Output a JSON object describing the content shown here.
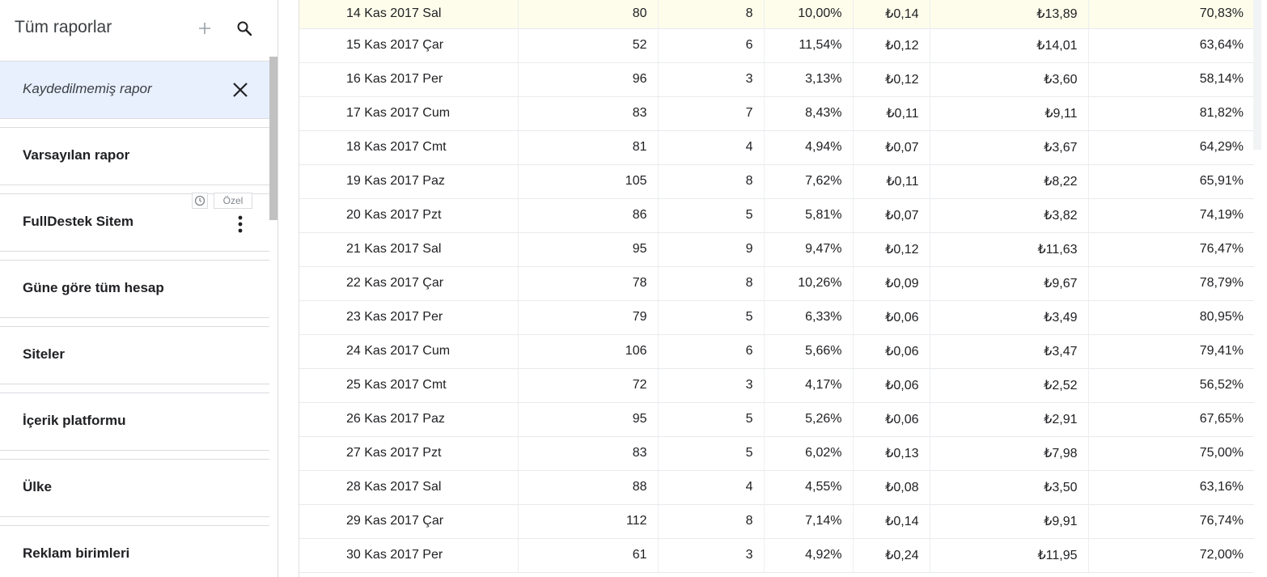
{
  "sidebar": {
    "title": "Tüm raporlar",
    "add_icon": "plus-icon",
    "search_icon": "search-icon",
    "selected_report": {
      "label": "Kaydedilmemiş rapor",
      "close_icon": "close-icon"
    },
    "reports": [
      {
        "label": "Varsayılan rapor"
      },
      {
        "label": "FullDestek Sitem",
        "badge": "Özel",
        "schedule_icon": "clock-icon",
        "menu_icon": "more-vert-icon"
      },
      {
        "label": "Güne göre tüm hesap"
      },
      {
        "label": "Siteler"
      },
      {
        "label": "İçerik platformu"
      },
      {
        "label": "Ülke"
      },
      {
        "label": "Reklam birimleri"
      }
    ]
  },
  "table": {
    "rows": [
      [
        "14 Kas 2017 Sal",
        "80",
        "8",
        "10,00%",
        "₺0,14",
        "₺13,89",
        "70,83%"
      ],
      [
        "15 Kas 2017 Çar",
        "52",
        "6",
        "11,54%",
        "₺0,12",
        "₺14,01",
        "63,64%"
      ],
      [
        "16 Kas 2017 Per",
        "96",
        "3",
        "3,13%",
        "₺0,12",
        "₺3,60",
        "58,14%"
      ],
      [
        "17 Kas 2017 Cum",
        "83",
        "7",
        "8,43%",
        "₺0,11",
        "₺9,11",
        "81,82%"
      ],
      [
        "18 Kas 2017 Cmt",
        "81",
        "4",
        "4,94%",
        "₺0,07",
        "₺3,67",
        "64,29%"
      ],
      [
        "19 Kas 2017 Paz",
        "105",
        "8",
        "7,62%",
        "₺0,11",
        "₺8,22",
        "65,91%"
      ],
      [
        "20 Kas 2017 Pzt",
        "86",
        "5",
        "5,81%",
        "₺0,07",
        "₺3,82",
        "74,19%"
      ],
      [
        "21 Kas 2017 Sal",
        "95",
        "9",
        "9,47%",
        "₺0,12",
        "₺11,63",
        "76,47%"
      ],
      [
        "22 Kas 2017 Çar",
        "78",
        "8",
        "10,26%",
        "₺0,09",
        "₺9,67",
        "78,79%"
      ],
      [
        "23 Kas 2017 Per",
        "79",
        "5",
        "6,33%",
        "₺0,06",
        "₺3,49",
        "80,95%"
      ],
      [
        "24 Kas 2017 Cum",
        "106",
        "6",
        "5,66%",
        "₺0,06",
        "₺3,47",
        "79,41%"
      ],
      [
        "25 Kas 2017 Cmt",
        "72",
        "3",
        "4,17%",
        "₺0,06",
        "₺2,52",
        "56,52%"
      ],
      [
        "26 Kas 2017 Paz",
        "95",
        "5",
        "5,26%",
        "₺0,06",
        "₺2,91",
        "67,65%"
      ],
      [
        "27 Kas 2017 Pzt",
        "83",
        "5",
        "6,02%",
        "₺0,13",
        "₺7,98",
        "75,00%"
      ],
      [
        "28 Kas 2017 Sal",
        "88",
        "4",
        "4,55%",
        "₺0,08",
        "₺3,50",
        "63,16%"
      ],
      [
        "29 Kas 2017 Çar",
        "112",
        "8",
        "7,14%",
        "₺0,14",
        "₺9,91",
        "76,74%"
      ],
      [
        "30 Kas 2017 Per",
        "61",
        "3",
        "4,92%",
        "₺0,24",
        "₺11,95",
        "72,00%"
      ]
    ]
  },
  "colors": {
    "selected_bg": "#e8f0fe",
    "highlight_row_bg": "#fefdeb",
    "divider": "#dadce0"
  }
}
